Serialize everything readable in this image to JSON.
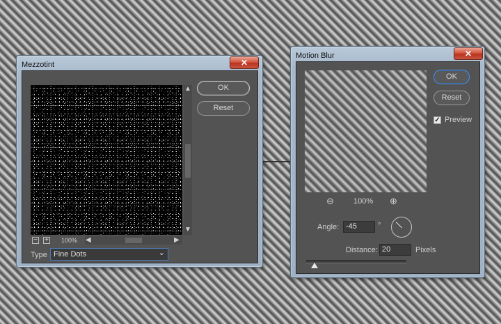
{
  "mezzotint": {
    "title": "Mezzotint",
    "close_glyph": "✕",
    "ok_label": "OK",
    "reset_label": "Reset",
    "zoom_out_glyph": "−",
    "zoom_in_glyph": "+",
    "zoom_value": "100%",
    "zoom_dropdown_glyph": "⌄",
    "type_label": "Type",
    "type_value": "Fine Dots",
    "type_dropdown_glyph": "⌄"
  },
  "motion_blur": {
    "title": "Motion Blur",
    "close_glyph": "✕",
    "ok_label": "OK",
    "reset_label": "Reset",
    "preview_label": "Preview",
    "preview_checked": true,
    "zoom_out_icon": "zoom-out-icon",
    "zoom_in_icon": "zoom-in-icon",
    "zoom_value": "100%",
    "angle_label": "Angle:",
    "angle_value": "-45",
    "angle_unit": "°",
    "distance_label": "Distance:",
    "distance_value": "20",
    "distance_unit": "Pixels"
  },
  "colors": {
    "dialog_bg": "#535353",
    "title_bar": "#a6b8ca",
    "close_button": "#cf4b35",
    "focus_blue": "#4b7bb5"
  }
}
